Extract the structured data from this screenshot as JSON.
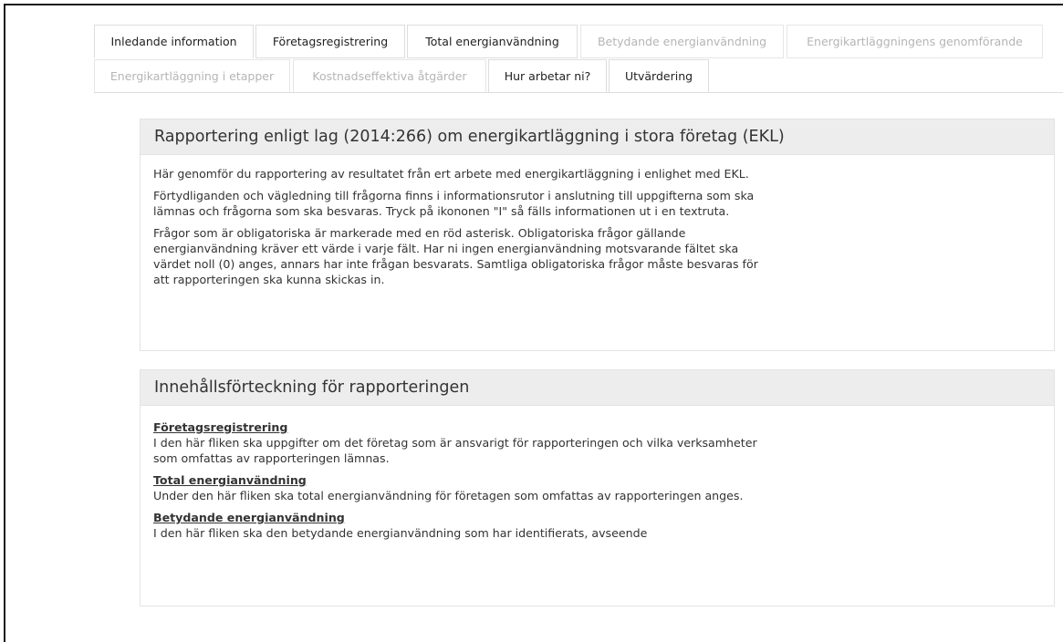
{
  "tabs": {
    "row1": [
      {
        "label": "Inledande information",
        "state": "active"
      },
      {
        "label": "Företagsregistrering",
        "state": "enabled"
      },
      {
        "label": "Total energianvändning",
        "state": "enabled"
      },
      {
        "label": "Betydande energianvändning",
        "state": "disabled"
      },
      {
        "label": "Energikartläggningens genomförande",
        "state": "disabled"
      }
    ],
    "row2": [
      {
        "label": "Energikartläggning i etapper",
        "state": "disabled"
      },
      {
        "label": "Kostnadseffektiva åtgärder",
        "state": "disabled"
      },
      {
        "label": "Hur arbetar ni?",
        "state": "enabled"
      },
      {
        "label": "Utvärdering",
        "state": "enabled"
      }
    ]
  },
  "intro": {
    "heading": "Rapportering enligt lag (2014:266) om energikartläggning i stora företag (EKL)",
    "paragraphs": [
      "Här genomför du rapportering av resultatet från ert arbete med energikartläggning i enlighet med EKL.",
      "Förtydliganden och vägledning till frågorna finns i informationsrutor i anslutning till uppgifterna som ska lämnas och frågorna som ska besvaras. Tryck på ikononen \"I\" så fälls informationen ut i en textruta.",
      "Frågor som är obligatoriska är markerade med en röd asterisk. Obligatoriska frågor gällande energianvändning kräver ett värde i varje fält. Har ni ingen energianvändning motsvarande fältet ska värdet noll (0) anges, annars har inte frågan besvarats. Samtliga obligatoriska frågor måste besvaras för att rapporteringen ska kunna skickas in."
    ]
  },
  "toc": {
    "heading": "Innehållsförteckning för rapporteringen",
    "sections": [
      {
        "title": "Företagsregistrering",
        "description": "I den här fliken ska uppgifter om det företag som är ansvarigt för rapporteringen och vilka verksamheter som omfattas av rapporteringen lämnas."
      },
      {
        "title": "Total energianvändning",
        "description": "Under den här fliken ska total energianvändning för företagen som omfattas av rapporteringen anges."
      },
      {
        "title": "Betydande energianvändning",
        "description": "I den här fliken ska den betydande energianvändning som har identifierats, avseende"
      }
    ]
  }
}
